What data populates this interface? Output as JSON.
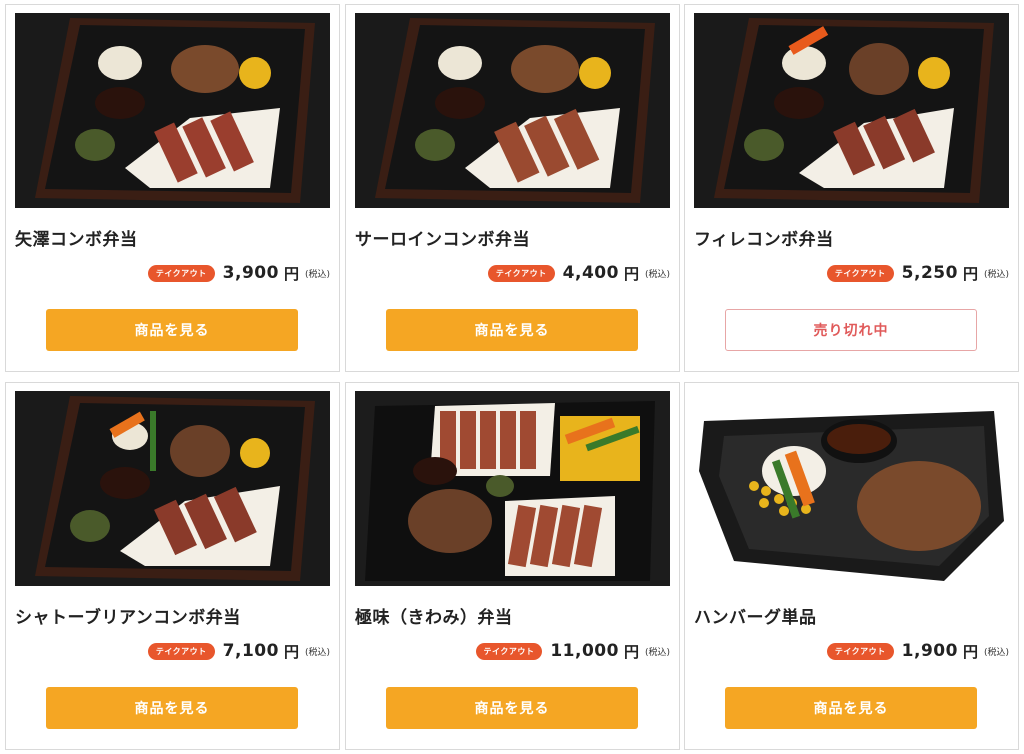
{
  "products": [
    {
      "name": "矢澤コンボ弁当",
      "badge": "テイクアウト",
      "price": "3,900",
      "unit": "円",
      "tax": "(税込)",
      "button": "商品を見る",
      "sold_out": false,
      "image": "combo-bento-photo"
    },
    {
      "name": "サーロインコンボ弁当",
      "badge": "テイクアウト",
      "price": "4,400",
      "unit": "円",
      "tax": "(税込)",
      "button": "商品を見る",
      "sold_out": false,
      "image": "combo-bento-photo"
    },
    {
      "name": "フィレコンボ弁当",
      "badge": "テイクアウト",
      "price": "5,250",
      "unit": "円",
      "tax": "(税込)",
      "button": "売り切れ中",
      "sold_out": true,
      "image": "combo-bento-photo"
    },
    {
      "name": "シャトーブリアンコンボ弁当",
      "badge": "テイクアウト",
      "price": "7,100",
      "unit": "円",
      "tax": "(税込)",
      "button": "商品を見る",
      "sold_out": false,
      "image": "combo-bento-photo"
    },
    {
      "name": "極味（きわみ）弁当",
      "badge": "テイクアウト",
      "price": "11,000",
      "unit": "円",
      "tax": "(税込)",
      "button": "商品を見る",
      "sold_out": false,
      "image": "kiwami-bento-photo"
    },
    {
      "name": "ハンバーグ単品",
      "badge": "テイクアウト",
      "price": "1,900",
      "unit": "円",
      "tax": "(税込)",
      "button": "商品を見る",
      "sold_out": false,
      "image": "hamburg-single-photo"
    }
  ],
  "colors": {
    "button": "#f5a623",
    "badge": "#e8562c",
    "soldout_text": "#e05a5a",
    "soldout_border": "#e7a6a6"
  }
}
